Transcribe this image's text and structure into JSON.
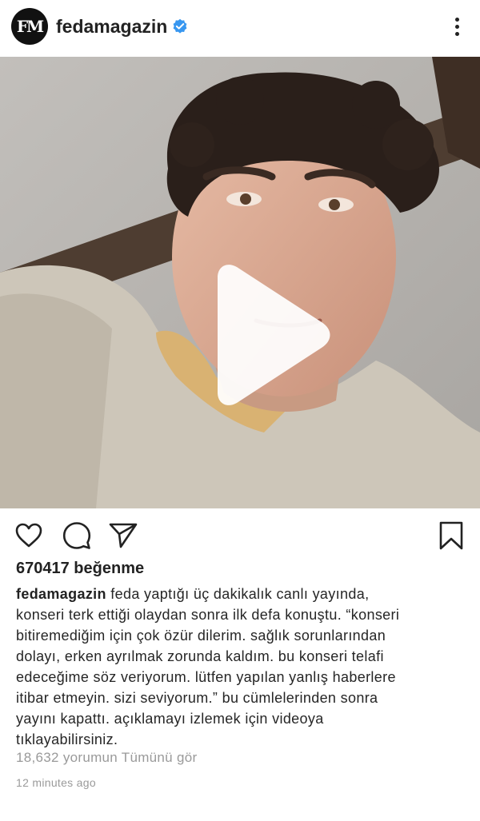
{
  "post": {
    "username": "fedamagazin",
    "avatar_text": "FM",
    "verified": true,
    "likes_text": "670417 beğenme",
    "caption_user": "fedamagazin",
    "caption_lines": [
      " feda yaptığı üç dakikalık canlı yayında,",
      "konseri terk ettiği olaydan sonra ilk defa konuştu. “konseri",
      "bitiremediğim için çok özür dilerim. sağlık sorunlarından",
      "dolayı, erken ayrılmak zorunda kaldım. bu konseri telafi",
      "edeceğime söz veriyorum. lütfen yapılan yanlış haberlere",
      "itibar etmeyin. sizi seviyorum.” bu cümlelerinden sonra",
      "yayını kapattı. açıklamayı izlemek için videoya",
      "tıklayabilirsiniz."
    ],
    "comments_text": "18,632 yorumun Tümünü gör",
    "time_text": "12 minutes ago"
  },
  "icons": {
    "more": "more-options-icon",
    "verified": "verified-badge-icon",
    "play": "play-icon",
    "like": "heart-icon",
    "comment": "comment-icon",
    "share": "send-icon",
    "save": "bookmark-icon"
  },
  "colors": {
    "verified": "#3897f0",
    "text": "#262626",
    "muted": "#9a9a9a"
  }
}
